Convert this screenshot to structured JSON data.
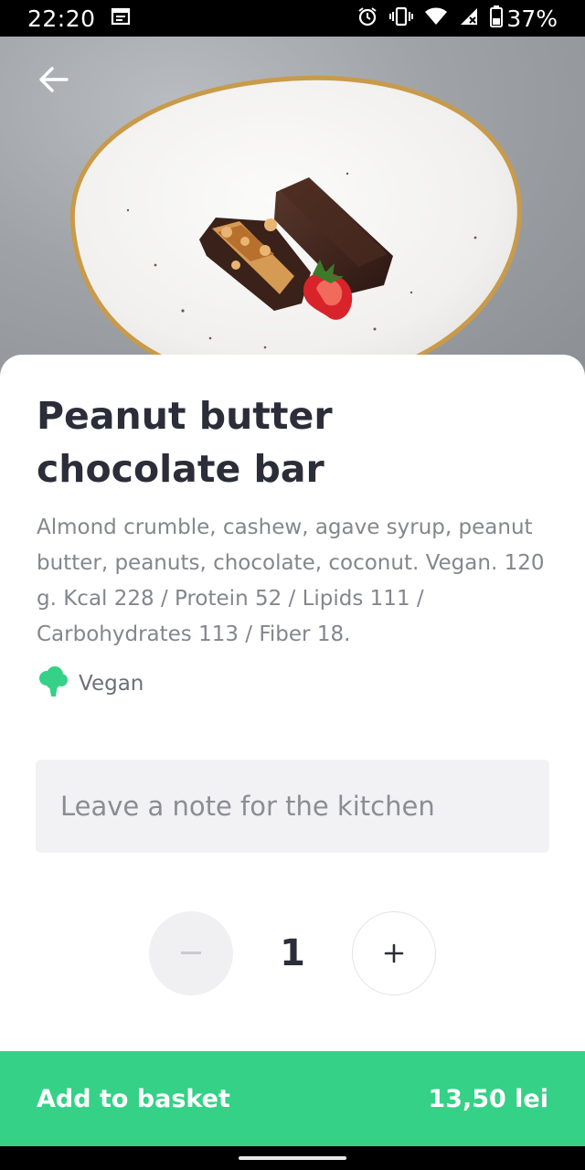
{
  "status_bar": {
    "time": "22:20",
    "battery_percent": "37%",
    "icons": [
      "calendar-icon",
      "alarm-icon",
      "vibrate-icon",
      "wifi-icon",
      "signal-icon",
      "battery-icon"
    ]
  },
  "hero": {
    "back_icon": "arrow-left-icon",
    "image_alt": "chocolate bar with peanuts and a strawberry on a white plate"
  },
  "product": {
    "title": "Peanut butter chocolate bar",
    "description": "Almond crumble, cashew, agave syrup, peanut butter, peanuts, chocolate, coconut. Vegan. 120 g. Kcal 228 / Protein 52 / Lipids 111 / Carbohydrates 113 / Fiber 18.",
    "tag": {
      "icon": "broccoli-icon",
      "label": "Vegan",
      "color": "#35d186"
    }
  },
  "note": {
    "placeholder": "Leave a note for the kitchen",
    "value": ""
  },
  "quantity": {
    "value": "1",
    "minus_icon": "minus-icon",
    "plus_icon": "plus-icon"
  },
  "basket": {
    "label": "Add to basket",
    "price": "13,50 lei",
    "color": "#35d186"
  }
}
